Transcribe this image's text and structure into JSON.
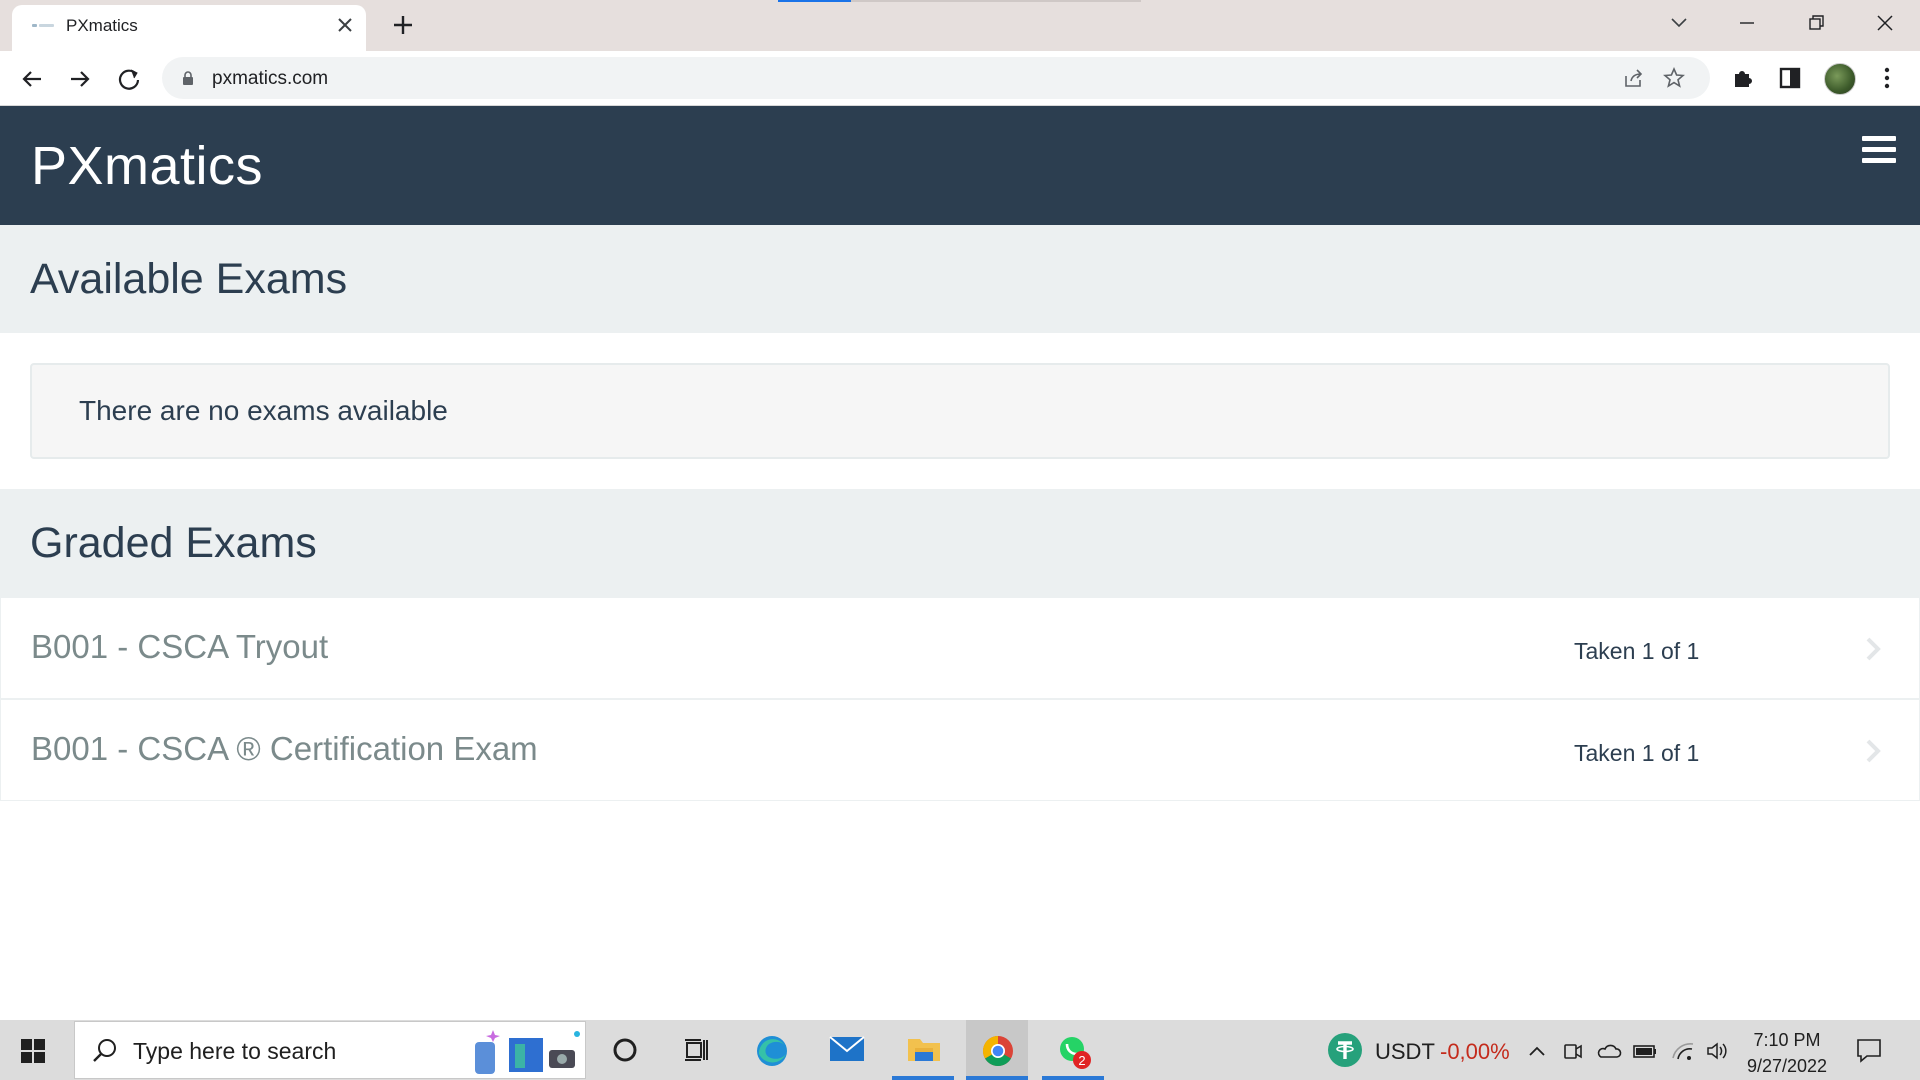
{
  "browser": {
    "tab_title": "PXmatics",
    "url": "pxmatics.com"
  },
  "app": {
    "brand": "PXmatics",
    "colors": {
      "header": "#2c3e50",
      "section": "#ecf0f1",
      "muted_text": "#7b8a8b"
    }
  },
  "available_exams": {
    "title": "Available Exams",
    "empty_message": "There are no exams available"
  },
  "graded_exams": {
    "title": "Graded Exams",
    "items": [
      {
        "name": "B001 - CSCA Tryout",
        "status": "Taken 1 of 1"
      },
      {
        "name": "B001 - CSCA ® Certification Exam",
        "status": "Taken 1 of 1"
      }
    ]
  },
  "taskbar": {
    "search_placeholder": "Type here to search",
    "whatsapp_badge": "2",
    "ticker_label": "USDT",
    "ticker_value": "-0,00%",
    "time": "7:10 PM",
    "date": "9/27/2022",
    "apps": [
      "cortana-icon",
      "task-view-icon",
      "edge-icon",
      "mail-icon",
      "file-explorer-icon",
      "chrome-icon",
      "whatsapp-icon"
    ]
  }
}
